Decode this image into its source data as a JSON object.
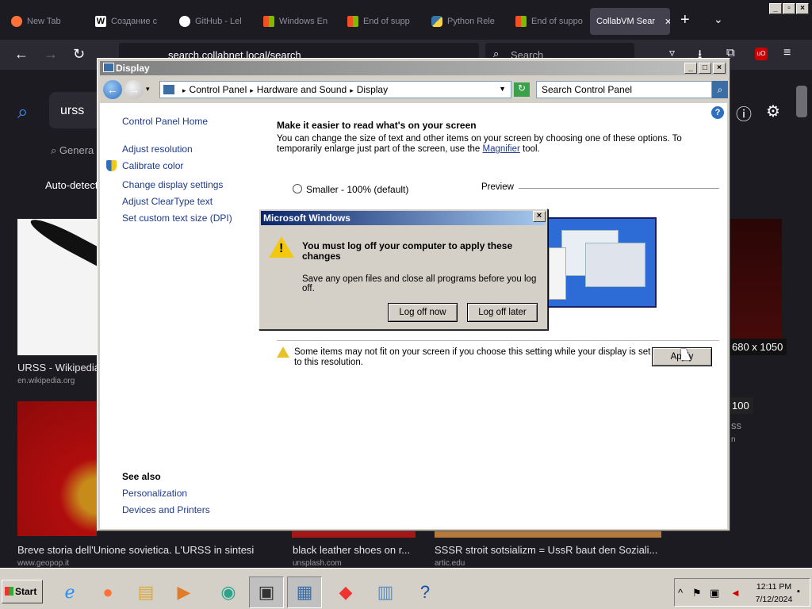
{
  "browser": {
    "tabs": [
      {
        "label": "New Tab",
        "color": "#ff7139"
      },
      {
        "label": "Создание с",
        "color": "#ffffff"
      },
      {
        "label": "GitHub - Lel",
        "color": "#ffffff"
      },
      {
        "label": "Windows En",
        "color": "#f25022"
      },
      {
        "label": "End of supp",
        "color": "#f25022"
      },
      {
        "label": "Python Rele",
        "color": "#3776ab"
      },
      {
        "label": "End of suppo",
        "color": "#f25022"
      },
      {
        "label": "CollabVM Sear",
        "color": "#42414d",
        "active": true
      }
    ],
    "url": "search.collabnet.local/search",
    "search_placeholder": "Search"
  },
  "web": {
    "query": "urss",
    "general_tab": "Genera",
    "auto_detect": "Auto-detect",
    "results": [
      {
        "title": "URSS - Wikipedia",
        "source": "en.wikipedia.org"
      },
      {
        "title": "Breve storia dell'Unione sovietica. L'URSS in sintesi",
        "source": "www.geopop.it"
      },
      {
        "title": "black leather shoes on r...",
        "source": "unsplash.com"
      },
      {
        "title": "SSSR stroit sotsializm = UssR baut den Soziali...",
        "source": "artic.edu"
      }
    ],
    "badge_res": "680 x 1050",
    "badge_small": "100",
    "side_text": "ss",
    "side_sub": "n"
  },
  "control_panel": {
    "title": "Display",
    "breadcrumb": [
      "Control Panel",
      "Hardware and Sound",
      "Display"
    ],
    "search_placeholder": "Search Control Panel",
    "left_links": [
      "Control Panel Home",
      "Adjust resolution",
      "Calibrate color",
      "Change display settings",
      "Adjust ClearType text",
      "Set custom text size (DPI)"
    ],
    "see_also_heading": "See also",
    "see_also_links": [
      "Personalization",
      "Devices and Printers"
    ],
    "heading": "Make it easier to read what's on your screen",
    "description_before": "You can change the size of text and other items on your screen by choosing one of these options. To temporarily enlarge just part of the screen, use the ",
    "description_link": "Magnifier",
    "description_after": " tool.",
    "option_smaller": "Smaller - 100% (default)",
    "preview_label": "Preview",
    "warning": "Some items may not fit on your screen if you choose this setting while your display is set to this resolution.",
    "apply_label": "Apply"
  },
  "dialog": {
    "title": "Microsoft Windows",
    "message": "You must log off your computer to apply these changes",
    "sub_message": "Save any open files and close all programs before you log off.",
    "log_off_now": "Log off now",
    "log_off_later": "Log off later"
  },
  "taskbar": {
    "start_label": "Start",
    "time": "12:11 PM",
    "date": "7/12/2024"
  }
}
